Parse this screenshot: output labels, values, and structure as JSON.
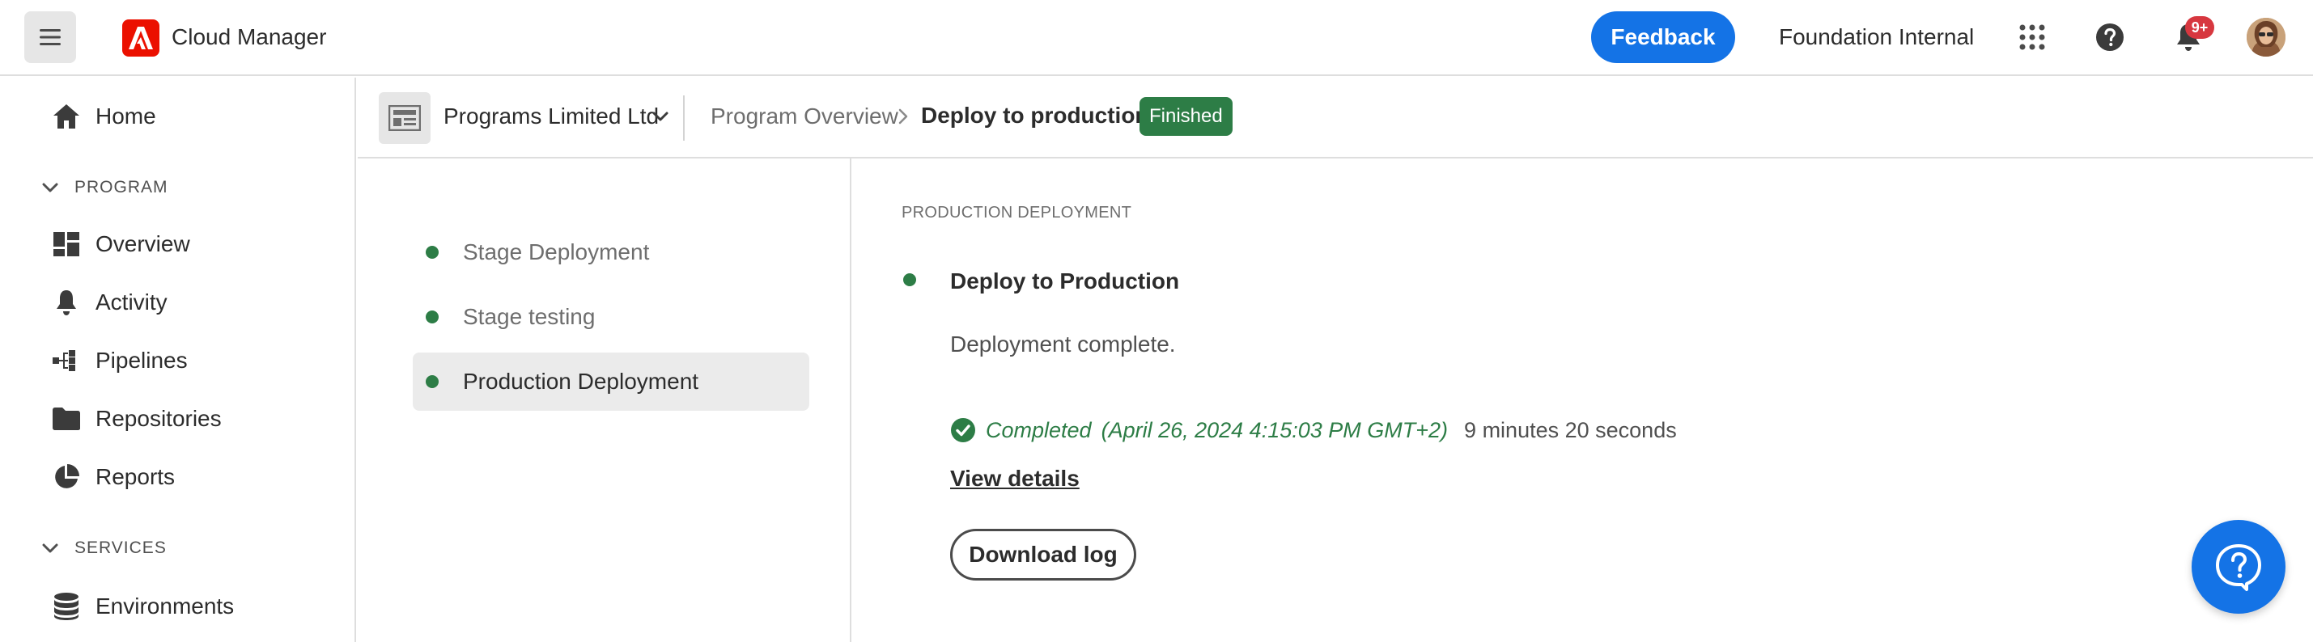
{
  "topbar": {
    "app_name": "Cloud Manager",
    "feedback_label": "Feedback",
    "org_name": "Foundation Internal",
    "notification_count": "9+",
    "icons": [
      "menu-icon",
      "adobe-logo",
      "apps-grid-icon",
      "help-icon",
      "bell-icon",
      "avatar"
    ]
  },
  "sidebar": {
    "home": {
      "label": "Home",
      "icon": "home-icon"
    },
    "program_heading": "PROGRAM",
    "program_items": [
      {
        "label": "Overview",
        "icon": "overview-icon"
      },
      {
        "label": "Activity",
        "icon": "bell-icon"
      },
      {
        "label": "Pipelines",
        "icon": "pipelines-icon"
      },
      {
        "label": "Repositories",
        "icon": "folder-icon"
      },
      {
        "label": "Reports",
        "icon": "pie-chart-icon"
      }
    ],
    "services_heading": "SERVICES",
    "services_items": [
      {
        "label": "Environments",
        "icon": "database-icon"
      }
    ]
  },
  "header": {
    "program_name": "Programs Limited Ltd",
    "breadcrumb_parent": "Program Overview",
    "breadcrumb_current": "Deploy to production",
    "status_badge": "Finished"
  },
  "steps": [
    {
      "label": "Stage Deployment",
      "active": false
    },
    {
      "label": "Stage testing",
      "active": false
    },
    {
      "label": "Production Deployment",
      "active": true
    }
  ],
  "detail": {
    "section_title": "PRODUCTION DEPLOYMENT",
    "step_title": "Deploy to Production",
    "description": "Deployment complete.",
    "status_text": "Completed",
    "status_date": "(April 26, 2024 4:15:03 PM GMT+2)",
    "duration": "9 minutes 20 seconds",
    "view_details_label": "View details",
    "download_log_label": "Download log"
  },
  "colors": {
    "accent_blue": "#1473e6",
    "success_green": "#2d7d46",
    "adobe_red": "#eb1000",
    "badge_red": "#d7373f"
  }
}
